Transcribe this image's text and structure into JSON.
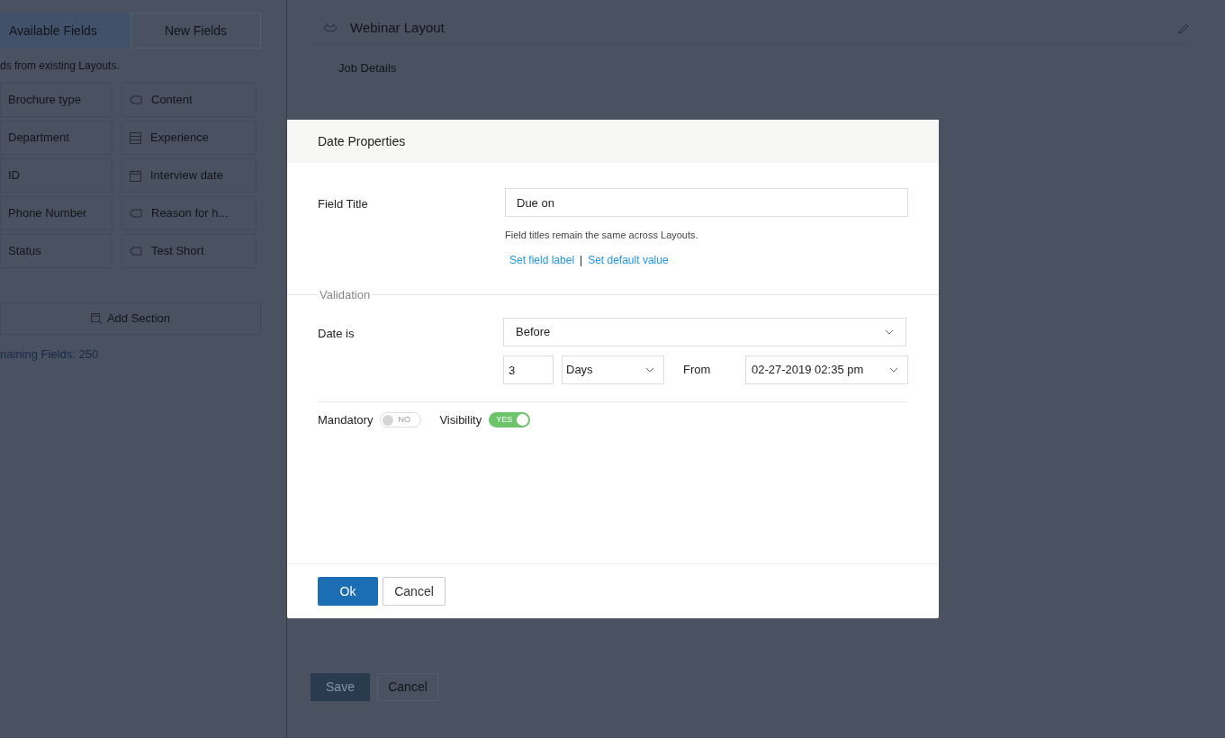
{
  "sidebar": {
    "tabs": [
      {
        "label": "Available Fields",
        "selected": true
      },
      {
        "label": "New Fields",
        "selected": false
      }
    ],
    "hint": "ds from existing Layouts.",
    "fields": [
      {
        "label": "Brochure type",
        "kind": "plain"
      },
      {
        "label": "Content",
        "kind": "text"
      },
      {
        "label": "Department",
        "kind": "plain"
      },
      {
        "label": "Experience",
        "kind": "form"
      },
      {
        "label": "ID",
        "kind": "plain"
      },
      {
        "label": "Interview date",
        "kind": "date"
      },
      {
        "label": "Phone Number",
        "kind": "plain"
      },
      {
        "label": "Reason for h...",
        "kind": "text"
      },
      {
        "label": "Status",
        "kind": "plain"
      },
      {
        "label": "Test Short",
        "kind": "text"
      }
    ],
    "add_section": "Add Section",
    "remaining": "naining Fields: 250"
  },
  "layout": {
    "title": "Webinar Layout",
    "section": "Job Details",
    "save": "Save",
    "cancel": "Cancel"
  },
  "dialog": {
    "title": "Date Properties",
    "field_title_label": "Field Title",
    "field_title_value": "Due on",
    "help": "Field titles remain the same across Layouts.",
    "links": [
      "Set field label",
      "Set default value"
    ],
    "separator": "|",
    "validation": "Validation",
    "date_is_label": "Date is",
    "condition": "Before",
    "amount": "3",
    "unit": "Days",
    "from_label": "From",
    "from_value": "02-27-2019 02:35 pm",
    "toggles": [
      {
        "label": "Mandatory",
        "on": false,
        "text": "NO"
      },
      {
        "label": "Visibility",
        "on": true,
        "text": "YES"
      }
    ],
    "ok": "Ok",
    "cancel": "Cancel"
  }
}
